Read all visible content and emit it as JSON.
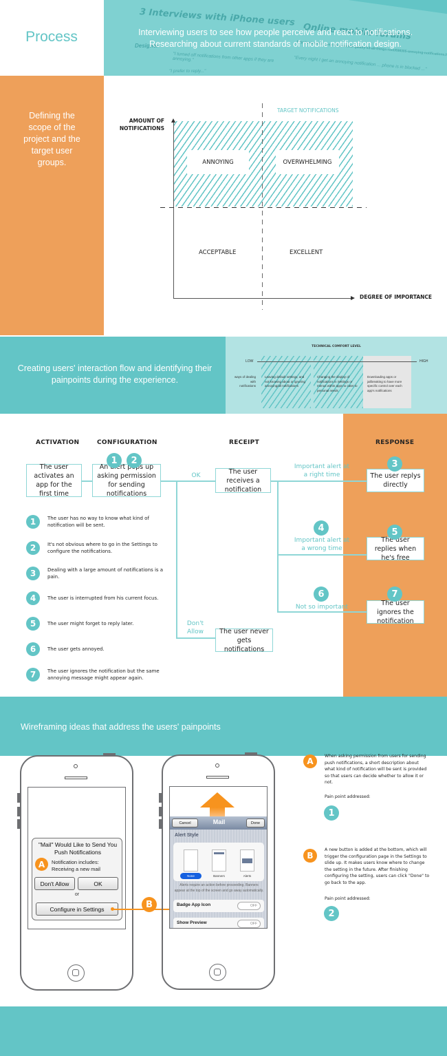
{
  "header": {
    "title": "Process",
    "description_line1": "Interviewing users to see how people perceive and react to notifications.",
    "description_line2": "Researching about current standards of mobile notification design.",
    "bg_heading1": "3 Interviews with iPhone users",
    "bg_heading2": "Online mobile forums",
    "bg_snippets": [
      "25 y.",
      "Designer",
      "Notifications for ... important things at work.",
      "\"I turned off notifications from other apps if they are annoying.\"",
      "\"I prefer to reply...\"",
      "http://androidforums.com/s-mobile-galaxy-s3-all-things-root/698305-annoying-notifications.html",
      "\"Every night I get an annoying notification ... phone is in blocked ...\""
    ]
  },
  "scope": {
    "description": "Defining the scope of the project and the target user groups.",
    "chart": {
      "y_axis_label_line1": "AMOUNT OF",
      "y_axis_label_line2": "NOTIFICATIONS",
      "x_axis_label": "DEGREE OF IMPORTANCE",
      "target_label": "TARGET NOTIFICATIONS",
      "quadrants": [
        "ANNOYING",
        "OVERWHELMING",
        "ACCEPTABLE",
        "EXCELLENT"
      ]
    }
  },
  "flow_intro": {
    "description": "Creating users' interaction flow and identifying their painpoints during the experience.",
    "comfort": {
      "title": "TECHNICAL COMFORT LEVEL",
      "low": "LOW",
      "high": "HIGH",
      "row_label": "ways of dealing with notifications",
      "columns": [
        "Leaving default settings, and not knowing about or ignoring annoying/all notifications",
        "Changing the display of notifications in Settings or menus within apps to cater to personal needs",
        "Downloading apps or jailbreaking to have more specific control over each app's notifications"
      ]
    }
  },
  "flow": {
    "stages": [
      "ACTIVATION",
      "CONFIGURATION",
      "RECEIPT",
      "RESPONSE"
    ],
    "boxes": {
      "activation": "The user activates an app for the first time",
      "configuration": "An alert pops up asking permission for sending notifications",
      "receipt": "The user receives a notification",
      "never": "The user never gets notifications",
      "reply_direct": "The user replys directly",
      "reply_free": "The user replies when he's free",
      "ignore": "The user ignores the notification"
    },
    "labels": {
      "ok": "OK",
      "dont_allow": "Don't Allow",
      "right_time": "Important alert at a right time",
      "wrong_time": "Important alert at a wrong time",
      "not_important": "Not so important"
    },
    "markers": [
      "1",
      "2",
      "3",
      "4",
      "5",
      "6",
      "7"
    ],
    "painpoints": [
      {
        "num": "1",
        "text": "The user has no way to know what kind of notification will be sent."
      },
      {
        "num": "2",
        "text": "It's not obvious where to go in the Settings to configure the notifications."
      },
      {
        "num": "3",
        "text": "Dealing with a large amount of notifications is a pain."
      },
      {
        "num": "4",
        "text": "The user is interrupted from his current focus."
      },
      {
        "num": "5",
        "text": "The user might forget to reply later."
      },
      {
        "num": "6",
        "text": "The user gets annoyed."
      },
      {
        "num": "7",
        "text": "The user ignores the notification but the same annoying message might appear again."
      }
    ]
  },
  "wireframes": {
    "title": "Wireframing ideas that address the users' painpoints",
    "phone1": {
      "alert_title": "\"Mail\" Would Like to Send You Push Notifications",
      "info_line1": "Notification includes:",
      "info_line2": "Receiving a new mail",
      "dont_allow": "Don't Allow",
      "ok": "OK",
      "or": "or",
      "configure": "Configure in Settings"
    },
    "phone2": {
      "cancel": "Cancel",
      "title": "Mail",
      "done": "Done",
      "section": "Alert Style",
      "styles": [
        "None",
        "Banners",
        "Alerts"
      ],
      "note": "Alerts require an action before proceeding. Banners appear at the top of the screen and go away automatically.",
      "toggles": [
        {
          "label": "Badge App Icon",
          "state": "OFF"
        },
        {
          "label": "Show Preview",
          "state": "OFF"
        }
      ]
    },
    "annotations": [
      {
        "marker": "A",
        "text": "When asking permission from users for sending push notifications, a short description about what kind of notification will be sent is provided so that users can decide whether to allow it or not.",
        "pain_label": "Pain point addressed:",
        "pain_num": "1"
      },
      {
        "marker": "B",
        "text": "A new button is added at the bottom, which will trigger the configuration page in the Settings to slide up. It makes users know where to change the setting in the future. After finishing configuring the setting, users can click \"Done\" to go back to the app.",
        "pain_label": "Pain point addressed:",
        "pain_num": "2"
      }
    ]
  },
  "colors": {
    "teal": "#63c5c6",
    "light_teal": "#b2e3e3",
    "orange": "#eea05a",
    "marker_orange": "#f7931e"
  }
}
